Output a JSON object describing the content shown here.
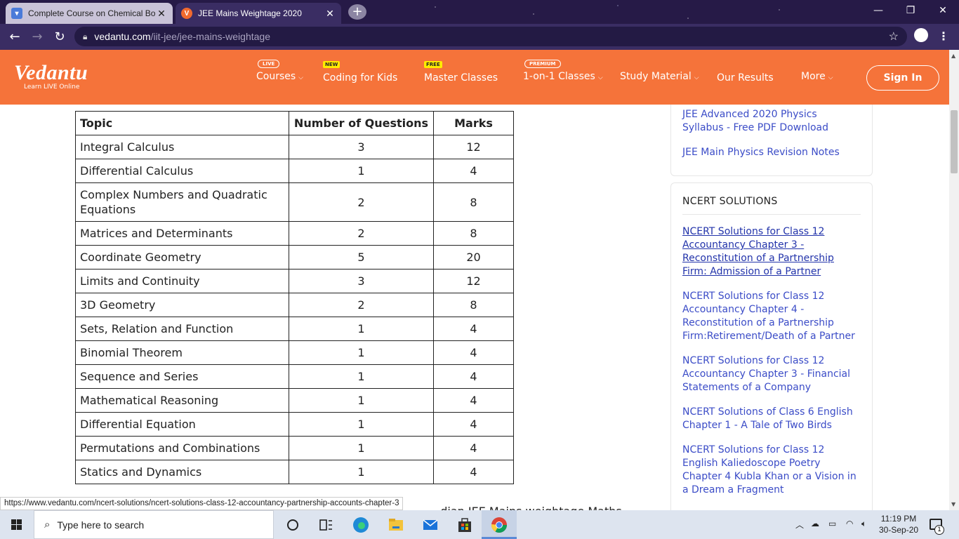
{
  "browser": {
    "tabs": [
      {
        "title": "Complete Course on Chemical Bo"
      },
      {
        "title": "JEE Mains Weightage 2020"
      }
    ],
    "url_host": "vedantu.com",
    "url_path": "/iit-jee/jee-mains-weightage"
  },
  "header": {
    "logo_name": "Vedantu",
    "logo_tagline": "Learn LIVE Online",
    "nav": [
      {
        "label": "Courses",
        "badge": "LIVE",
        "caret": true
      },
      {
        "label": "Coding for Kids",
        "badge": "NEW",
        "caret": false
      },
      {
        "label": "Master Classes",
        "badge": "FREE",
        "caret": false
      },
      {
        "label": "1-on-1 Classes",
        "badge": "PREMIUM",
        "caret": true
      },
      {
        "label": "Study Material",
        "badge": "",
        "caret": true
      },
      {
        "label": "Our Results",
        "badge": "",
        "caret": false
      },
      {
        "label": "More",
        "badge": "",
        "caret": true
      }
    ],
    "signin_label": "Sign In"
  },
  "table": {
    "headers": [
      "Topic",
      "Number of Questions",
      "Marks"
    ],
    "rows": [
      {
        "topic": "Integral Calculus",
        "questions": "3",
        "marks": "12"
      },
      {
        "topic": "Differential Calculus",
        "questions": "1",
        "marks": "4"
      },
      {
        "topic": "Complex Numbers and Quadratic Equations",
        "questions": "2",
        "marks": "8"
      },
      {
        "topic": "Matrices and Determinants",
        "questions": "2",
        "marks": "8"
      },
      {
        "topic": "Coordinate Geometry",
        "questions": "5",
        "marks": "20"
      },
      {
        "topic": "Limits and Continuity",
        "questions": "3",
        "marks": "12"
      },
      {
        "topic": "3D Geometry",
        "questions": "2",
        "marks": "8"
      },
      {
        "topic": "Sets, Relation and Function",
        "questions": "1",
        "marks": "4"
      },
      {
        "topic": "Binomial Theorem",
        "questions": "1",
        "marks": "4"
      },
      {
        "topic": "Sequence and Series",
        "questions": "1",
        "marks": "4"
      },
      {
        "topic": "Mathematical Reasoning",
        "questions": "1",
        "marks": "4"
      },
      {
        "topic": "Differential Equation",
        "questions": "1",
        "marks": "4"
      },
      {
        "topic": "Permutations and Combinations",
        "questions": "1",
        "marks": "4"
      },
      {
        "topic": "Statics and Dynamics",
        "questions": "1",
        "marks": "4"
      }
    ]
  },
  "sidebar": {
    "related_links": [
      "JEE Advanced 2020 Physics Syllabus - Free PDF Download",
      "JEE Main Physics Revision Notes"
    ],
    "ncert_title": "NCERT SOLUTIONS",
    "ncert_links": [
      "NCERT Solutions for Class 12 Accountancy Chapter 3 - Reconstitution of a Partnership Firm: Admission of a Partner",
      "NCERT Solutions for Class 12 Accountancy Chapter 4 - Reconstitution of a Partnership Firm:Retirement/Death of a Partner",
      "NCERT Solutions for Class 12 Accountancy Chapter 3 - Financial Statements of a Company",
      "NCERT Solutions of Class 6 English Chapter 1 - A Tale of Two Birds",
      "NCERT Solutions for Class 12 English Kaliedoscope Poetry Chapter 4 Kubla Khan or a Vision in a Dream a Fragment"
    ]
  },
  "status_url": "https://www.vedantu.com/ncert-solutions/ncert-solutions-class-12-accountancy-partnership-accounts-chapter-3",
  "peek_text": "...dian JEE Mains weightage Maths",
  "taskbar": {
    "search_placeholder": "Type here to search",
    "time": "11:19 PM",
    "date": "30-Sep-20",
    "notification_count": "1"
  },
  "colors": {
    "brand_orange": "#f5733a",
    "browser_frame": "#3a2d63",
    "link_blue": "#3b4cc7"
  }
}
